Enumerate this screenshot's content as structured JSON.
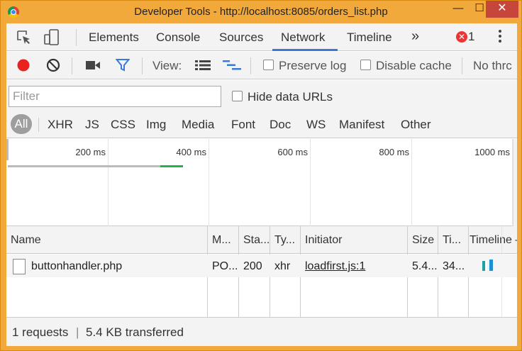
{
  "window": {
    "title": "Developer Tools - http://localhost:8085/orders_list.php",
    "minimize_glyph": "—",
    "maximize_glyph": "☐",
    "close_glyph": "✕"
  },
  "tabs": [
    {
      "label": "Elements"
    },
    {
      "label": "Console"
    },
    {
      "label": "Sources"
    },
    {
      "label": "Network"
    },
    {
      "label": "Timeline"
    }
  ],
  "tabs_more_glyph": "»",
  "active_tab": "Network",
  "errors": {
    "badge_glyph": "✕",
    "count": "1"
  },
  "toolbar": {
    "view_label": "View:",
    "preserve_log_label": "Preserve log",
    "disable_cache_label": "Disable cache",
    "throttle_label": "No thrc",
    "record_color": "#e8231f",
    "filter_color": "#3879d9"
  },
  "filter": {
    "placeholder": "Filter",
    "value": "",
    "hide_data_urls_label": "Hide data URLs"
  },
  "types": [
    "All",
    "XHR",
    "JS",
    "CSS",
    "Img",
    "Media",
    "Font",
    "Doc",
    "WS",
    "Manifest",
    "Other"
  ],
  "overview": {
    "ticks": [
      "200 ms",
      "400 ms",
      "600 ms",
      "800 ms",
      "1000 ms"
    ]
  },
  "table": {
    "columns": [
      "Name",
      "M...",
      "Sta...",
      "Ty...",
      "Initiator",
      "Size",
      "Ti...",
      "Timeline –"
    ],
    "rows": [
      {
        "name": "buttonhandler.php",
        "method": "PO...",
        "status": "200",
        "type": "xhr",
        "initiator": "loadfirst.js:1",
        "size": "5.4...",
        "time": "34..."
      }
    ]
  },
  "status": {
    "requests": "1 requests",
    "separator": "|",
    "transferred": "5.4 KB transferred"
  }
}
